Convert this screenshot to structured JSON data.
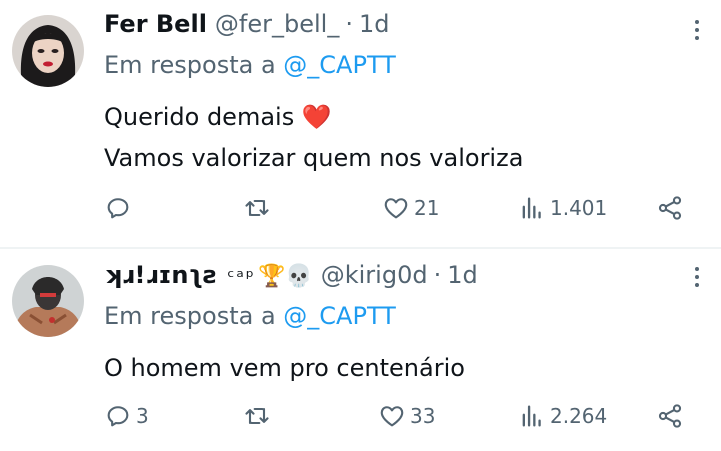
{
  "tweets": [
    {
      "name": "Fer Bell",
      "name_extra": "",
      "handle": "@fer_bell_",
      "dot": "·",
      "time": "1d",
      "reply_prefix": "Em resposta a",
      "reply_handle": "@_CAPTT",
      "lines": [
        "Querido demais",
        "Vamos valorizar quem nos valoriza"
      ],
      "line1_emoji": "❤️",
      "replies": "",
      "retweets": "",
      "likes": "21",
      "views": "1.401"
    },
    {
      "name": "ʞɹ!ɹɪnʅƨ",
      "name_extra": "ᶜᵃᵖ",
      "name_emojis": "🏆💀",
      "handle": "@kirig0d",
      "dot": "·",
      "time": "1d",
      "reply_prefix": "Em resposta a",
      "reply_handle": "@_CAPTT",
      "lines": [
        "O homem vem pro centenário"
      ],
      "replies": "3",
      "retweets": "",
      "likes": "33",
      "views": "2.264"
    }
  ],
  "icons": [
    "reply-icon",
    "retweet-icon",
    "like-icon",
    "views-icon",
    "share-icon",
    "more-icon"
  ],
  "colors": {
    "link": "#1d9bf0",
    "muted": "#536471",
    "text": "#0f1419",
    "divider": "#eff3f4"
  }
}
